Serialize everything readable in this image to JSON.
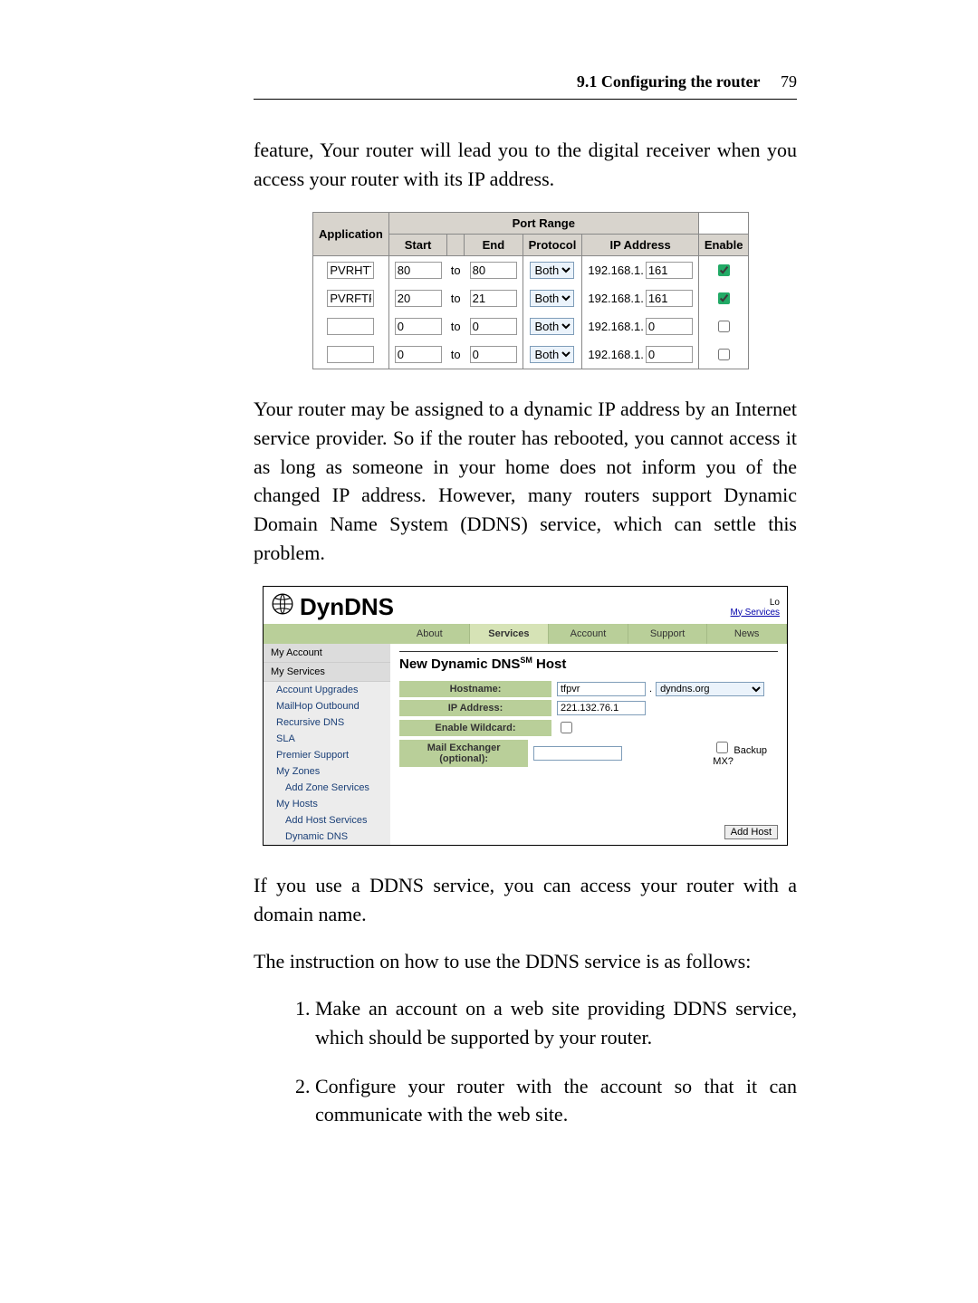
{
  "header": {
    "section": "9.1 Configuring the router",
    "page": "79"
  },
  "para1": "feature, Your router will lead you to the digital receiver when you access your router with its IP address.",
  "port_table": {
    "group_header": "Port Range",
    "cols": {
      "app": "Application",
      "start": "Start",
      "end": "End",
      "proto": "Protocol",
      "ip": "IP Address",
      "enable": "Enable"
    },
    "to_label": "to",
    "ip_prefix": "192.168.1.",
    "proto_option": "Both",
    "rows": [
      {
        "app": "PVRHTTP",
        "start": "80",
        "end": "80",
        "ip_suffix": "161",
        "enabled": true
      },
      {
        "app": "PVRFTP",
        "start": "20",
        "end": "21",
        "ip_suffix": "161",
        "enabled": true
      },
      {
        "app": "",
        "start": "0",
        "end": "0",
        "ip_suffix": "0",
        "enabled": false
      },
      {
        "app": "",
        "start": "0",
        "end": "0",
        "ip_suffix": "0",
        "enabled": false
      }
    ]
  },
  "para2": "Your router may be assigned to a dynamic IP address by an Internet service provider. So if the router has rebooted, you cannot access it as long as someone in your home does not inform you of the changed IP address. However, many routers support Dynamic Domain Name System (DDNS) service, which can settle this problem.",
  "dyndns": {
    "logo_text": "DynDNS",
    "top_links": {
      "lo": "Lo",
      "svc": "My Services"
    },
    "tabs": [
      "About",
      "Services",
      "Account",
      "Support",
      "News"
    ],
    "active_tab": 1,
    "sidebar": {
      "hdr1": "My Account",
      "hdr2": "My Services",
      "items": [
        "Account Upgrades",
        "MailHop Outbound",
        "Recursive DNS",
        "SLA",
        "Premier Support",
        "My Zones",
        "Add Zone Services",
        "My Hosts",
        "Add Host Services",
        "Dynamic DNS"
      ],
      "sub_indices": [
        6,
        8,
        9
      ]
    },
    "main": {
      "title_prefix": "New Dynamic DNS",
      "title_suffix": " Host",
      "sm": "SM",
      "labels": {
        "hostname": "Hostname:",
        "ip": "IP Address:",
        "wildcard": "Enable Wildcard:",
        "mx": "Mail Exchanger (optional):"
      },
      "hostname_value": "tfpvr",
      "domain_option": "dyndns.org",
      "ip_value": "221.132.76.1",
      "wildcard_checked": false,
      "mx_value": "",
      "backup_mx_label": "Backup MX?",
      "backup_mx_checked": false,
      "add_button": "Add Host"
    }
  },
  "para3": "If you use a DDNS service, you can access your router with a domain name.",
  "para4": "The instruction on how to use the DDNS service is as follows:",
  "steps": [
    "Make an account on a web site providing DDNS service, which should be supported by your router.",
    "Configure your router with the account so that it can communicate with the web site."
  ]
}
